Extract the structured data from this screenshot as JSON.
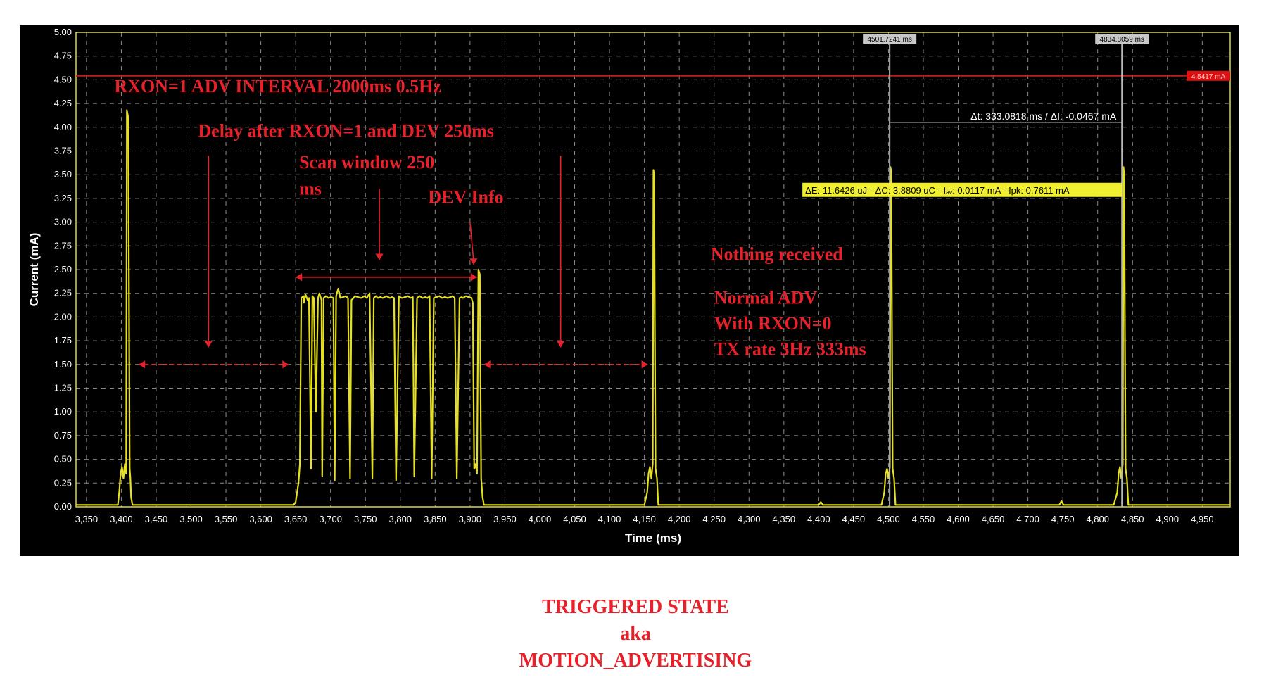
{
  "colors": {
    "trace": "#e6e020",
    "annotation": "#e8202a",
    "grid": "#8a8a8a",
    "axis_text": "#ffffff",
    "background": "#000000",
    "plot_border": "#d8d84a"
  },
  "chart_data": {
    "type": "line",
    "xlabel": "Time (ms)",
    "ylabel": "Current (mA)",
    "xlim": [
      3335,
      4990
    ],
    "ylim": [
      0,
      5
    ],
    "grid": true,
    "x_ticks": [
      "3,350",
      "3,400",
      "3,450",
      "3,500",
      "3,550",
      "3,600",
      "3,650",
      "3,700",
      "3,750",
      "3,800",
      "3,850",
      "3,900",
      "3,950",
      "4,000",
      "4,050",
      "4,100",
      "4,150",
      "4,200",
      "4,250",
      "4,300",
      "4,350",
      "4,400",
      "4,450",
      "4,500",
      "4,550",
      "4,600",
      "4,650",
      "4,700",
      "4,750",
      "4,800",
      "4,850",
      "4,900",
      "4,950"
    ],
    "y_ticks": [
      "0.00",
      "0.25",
      "0.50",
      "0.75",
      "1.00",
      "1.25",
      "1.50",
      "1.75",
      "2.00",
      "2.25",
      "2.50",
      "2.75",
      "3.00",
      "3.25",
      "3.50",
      "3.75",
      "4.00",
      "4.25",
      "4.50",
      "4.75",
      "5.00"
    ],
    "series": [
      {
        "x": [
          3335,
          3395,
          3397,
          3399,
          3401,
          3403,
          3405,
          3407,
          3408,
          3410,
          3412,
          3413,
          3414,
          3416,
          3420,
          3647,
          3650,
          3654,
          3656,
          3658,
          3661,
          3662,
          3664,
          3666,
          3667,
          3669,
          3672,
          3674,
          3676,
          3679,
          3682,
          3684,
          3687,
          3688,
          3690,
          3693,
          3697,
          3701,
          3704,
          3706,
          3708,
          3711,
          3714,
          3718,
          3722,
          3725,
          3728,
          3730,
          3733,
          3735,
          3739,
          3744,
          3748,
          3752,
          3756,
          3760,
          3762,
          3765,
          3768,
          3771,
          3775,
          3780,
          3785,
          3788,
          3791,
          3794,
          3798,
          3802,
          3807,
          3811,
          3815,
          3818,
          3820,
          3824,
          3828,
          3832,
          3836,
          3839,
          3842,
          3845,
          3848,
          3852,
          3856,
          3860,
          3864,
          3868,
          3872,
          3875,
          3878,
          3881,
          3885,
          3888,
          3890,
          3894,
          3898,
          3902,
          3904,
          3906,
          3908,
          3910,
          3912,
          3914,
          3916,
          3918,
          3920,
          3924,
          4150,
          4154,
          4156,
          4158,
          4160,
          4162,
          4163,
          4164,
          4166,
          4168,
          4170,
          4175,
          4400,
          4403,
          4406,
          4490,
          4494,
          4496,
          4498,
          4500,
          4502,
          4503,
          4504,
          4506,
          4508,
          4510,
          4515,
          4745,
          4748,
          4751,
          4823,
          4828,
          4830,
          4832,
          4834,
          4836,
          4837,
          4838,
          4840,
          4842,
          4844,
          4850,
          4990
        ],
        "y": [
          0.02,
          0.02,
          0.15,
          0.35,
          0.42,
          0.3,
          0.45,
          0.35,
          4.18,
          4.1,
          0.4,
          0.3,
          0.1,
          0.02,
          0.02,
          0.02,
          0.05,
          0.25,
          0.45,
          2.2,
          2.22,
          2.15,
          2.24,
          2.2,
          2.18,
          2.2,
          0.4,
          2.22,
          2.2,
          1.0,
          2.2,
          2.25,
          2.18,
          0.32,
          2.2,
          2.22,
          2.2,
          2.21,
          2.2,
          0.28,
          2.22,
          2.3,
          2.2,
          2.21,
          2.22,
          2.2,
          0.3,
          2.18,
          2.2,
          2.22,
          2.21,
          2.2,
          2.22,
          2.2,
          2.25,
          0.3,
          2.2,
          2.22,
          2.2,
          2.21,
          2.2,
          2.22,
          2.2,
          2.21,
          2.2,
          0.28,
          2.22,
          2.2,
          2.21,
          2.22,
          2.2,
          2.21,
          0.32,
          2.2,
          2.22,
          2.2,
          2.21,
          2.2,
          2.22,
          0.3,
          2.2,
          2.21,
          2.22,
          2.2,
          2.21,
          2.2,
          2.21,
          2.22,
          2.2,
          0.3,
          2.2,
          2.21,
          2.2,
          2.22,
          2.21,
          2.2,
          2.15,
          0.4,
          0.45,
          0.35,
          2.5,
          2.45,
          0.3,
          0.1,
          0.02,
          0.02,
          0.02,
          0.15,
          0.35,
          0.42,
          0.3,
          0.45,
          3.55,
          3.5,
          0.4,
          0.3,
          0.02,
          0.02,
          0.02,
          0.05,
          0.02,
          0.02,
          0.15,
          0.35,
          0.4,
          0.3,
          0.42,
          3.58,
          3.52,
          0.4,
          0.3,
          0.02,
          0.02,
          0.02,
          0.06,
          0.02,
          0.02,
          0.15,
          0.35,
          0.42,
          0.3,
          0.45,
          3.58,
          3.5,
          0.4,
          0.3,
          0.02,
          0.02,
          0.02
        ]
      }
    ],
    "reference_line": {
      "y": 4.5417,
      "label": "4.5417 mA"
    },
    "cursors": [
      {
        "x": 4501.7241,
        "label": "4501.7241 ms"
      },
      {
        "x": 4834.8059,
        "label": "4834.8059 ms"
      }
    ],
    "cursor_measure": "Δt: 333.0818 ms / ΔI: -0.0467 mA",
    "energy_box": "ΔE: 11.6426 uJ - ΔC: 3.8809 uC - Iₐᵥ: 0.0117 mA - Ipk: 0.7611 mA",
    "annotations": [
      {
        "id": "adv-interval",
        "text": "RXON=1 ADV INTERVAL 2000ms 0.5Hz"
      },
      {
        "id": "delay",
        "text": "Delay after RXON=1 and DEV 250ms"
      },
      {
        "id": "scan-1",
        "text": "Scan window 250"
      },
      {
        "id": "scan-2",
        "text": "ms"
      },
      {
        "id": "dev-info",
        "text": "DEV Info"
      },
      {
        "id": "nothing",
        "text": "Nothing received"
      },
      {
        "id": "normal-1",
        "text": "Normal ADV"
      },
      {
        "id": "normal-2",
        "text": "With RXON=0"
      },
      {
        "id": "normal-3",
        "text": "TX rate 3Hz 333ms"
      }
    ]
  },
  "caption": {
    "line1": "TRIGGERED STATE",
    "line2": "aka",
    "line3": "MOTION_ADVERTISING"
  }
}
